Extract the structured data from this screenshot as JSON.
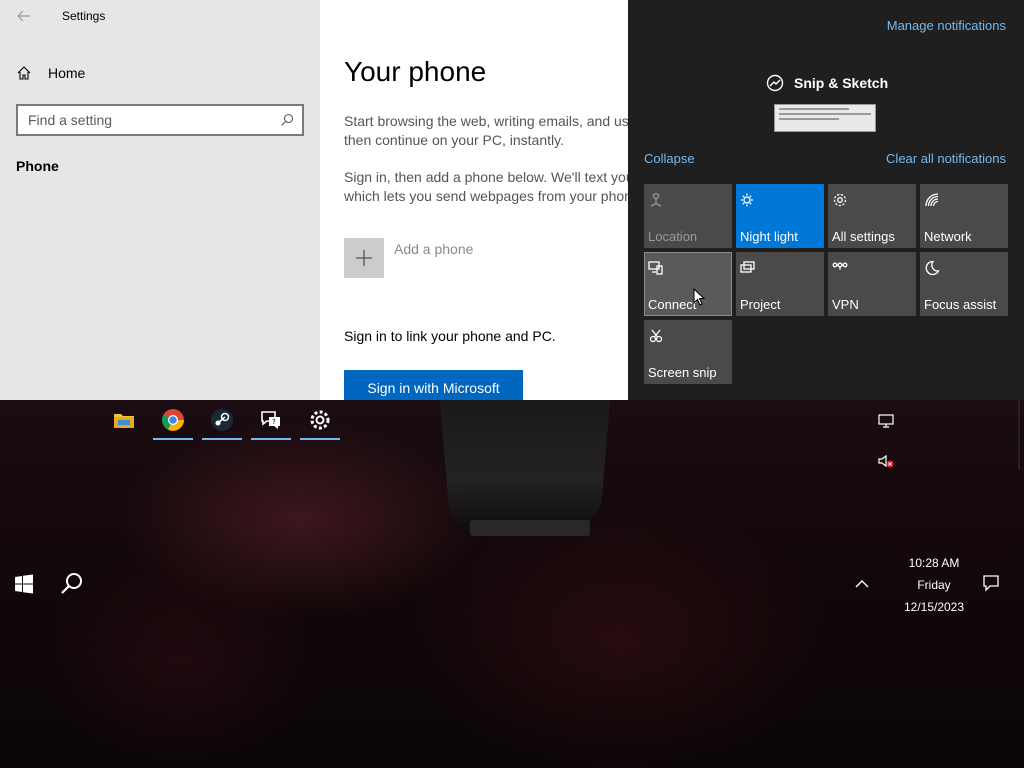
{
  "settings": {
    "window_title": "Settings",
    "sidebar": {
      "home_label": "Home",
      "search_placeholder": "Find a setting",
      "current_item": "Phone"
    },
    "page": {
      "title": "Your phone",
      "desc1_line1": "Start browsing the web, writing emails, and us",
      "desc1_line2": "then continue on your PC, instantly.",
      "desc2_line1": "Sign in, then add a phone below. We'll text you",
      "desc2_line2": "which lets you send webpages from your phon",
      "add_phone_label": "Add a phone",
      "signin_text": "Sign in to link your phone and PC.",
      "signin_button": "Sign in with Microsoft"
    }
  },
  "action_center": {
    "manage_notifications": "Manage notifications",
    "notification_app": "Snip & Sketch",
    "collapse": "Collapse",
    "clear_all": "Clear all notifications",
    "tiles": [
      {
        "label": "Location",
        "icon": "location-icon",
        "state": "disabled"
      },
      {
        "label": "Night light",
        "icon": "night-light-icon",
        "state": "active"
      },
      {
        "label": "All settings",
        "icon": "gear-icon",
        "state": "normal"
      },
      {
        "label": "Network",
        "icon": "network-icon",
        "state": "normal"
      },
      {
        "label": "Connect",
        "icon": "connect-icon",
        "state": "hover"
      },
      {
        "label": "Project",
        "icon": "project-icon",
        "state": "normal"
      },
      {
        "label": "VPN",
        "icon": "vpn-icon",
        "state": "normal"
      },
      {
        "label": "Focus assist",
        "icon": "moon-icon",
        "state": "normal"
      },
      {
        "label": "Screen snip",
        "icon": "screen-snip-icon",
        "state": "normal"
      }
    ],
    "accent_color": "#0078d7",
    "link_color": "#76b9ed"
  },
  "taskbar": {
    "apps": [
      {
        "name": "File Explorer",
        "icon": "folder-icon",
        "running": false
      },
      {
        "name": "Google Chrome",
        "icon": "chrome-icon",
        "running": true
      },
      {
        "name": "Steam",
        "icon": "steam-icon",
        "running": true
      },
      {
        "name": "Get Help",
        "icon": "help-icon",
        "running": true
      },
      {
        "name": "Settings",
        "icon": "gear-icon",
        "running": true
      }
    ],
    "clock": {
      "time": "10:28 AM",
      "day": "Friday",
      "date": "12/15/2023"
    }
  }
}
